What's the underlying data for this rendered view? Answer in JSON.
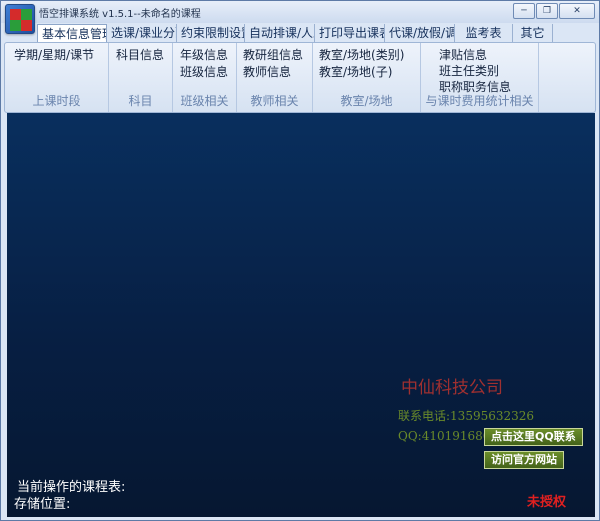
{
  "window": {
    "title": "悟空排课系统 v1.5.1--未命名的课程",
    "controls": {
      "minimize": "─",
      "restore": "❐",
      "close": "✕"
    }
  },
  "tabs": [
    {
      "label": "基本信息管理",
      "active": true
    },
    {
      "label": "选课/课业分配",
      "active": false
    },
    {
      "label": "约束限制设置",
      "active": false
    },
    {
      "label": "自动排课/人工调整",
      "active": false
    },
    {
      "label": "打印导出课表",
      "active": false
    },
    {
      "label": "代课/放假/调课",
      "active": false
    },
    {
      "label": "监考表",
      "active": false
    },
    {
      "label": "其它",
      "active": false
    }
  ],
  "ribbon": {
    "groups": [
      {
        "label": "上课时段",
        "items": [
          "学期/星期/课节"
        ]
      },
      {
        "label": "科目",
        "items": [
          "科目信息"
        ]
      },
      {
        "label": "班级相关",
        "items": [
          "年级信息",
          "班级信息"
        ]
      },
      {
        "label": "教师相关",
        "items": [
          "教研组信息",
          "教师信息"
        ]
      },
      {
        "label": "教室/场地",
        "items": [
          "教室/场地(类别)",
          "教室/场地(子)"
        ]
      },
      {
        "label": "与课时费用统计相关",
        "items": [
          "津贴信息",
          "班主任类别",
          "职称职务信息"
        ]
      }
    ]
  },
  "main": {
    "company": "中仙科技公司",
    "phone": "联系电话:13595632326",
    "qq": "QQ:410191680",
    "qq_button": "点击这里QQ联系",
    "website_button": "访问官方网站",
    "current_table_label": "当前操作的课程表:",
    "storage_label": "存储位置:",
    "unauthorized": "未授权"
  },
  "colors": {
    "canvas_top": "#092f5e",
    "canvas_bottom": "#061731",
    "company": "#a03030",
    "contact": "#6a8a2a",
    "button_green": "#5a7a22",
    "unauthorized": "#e02020"
  }
}
